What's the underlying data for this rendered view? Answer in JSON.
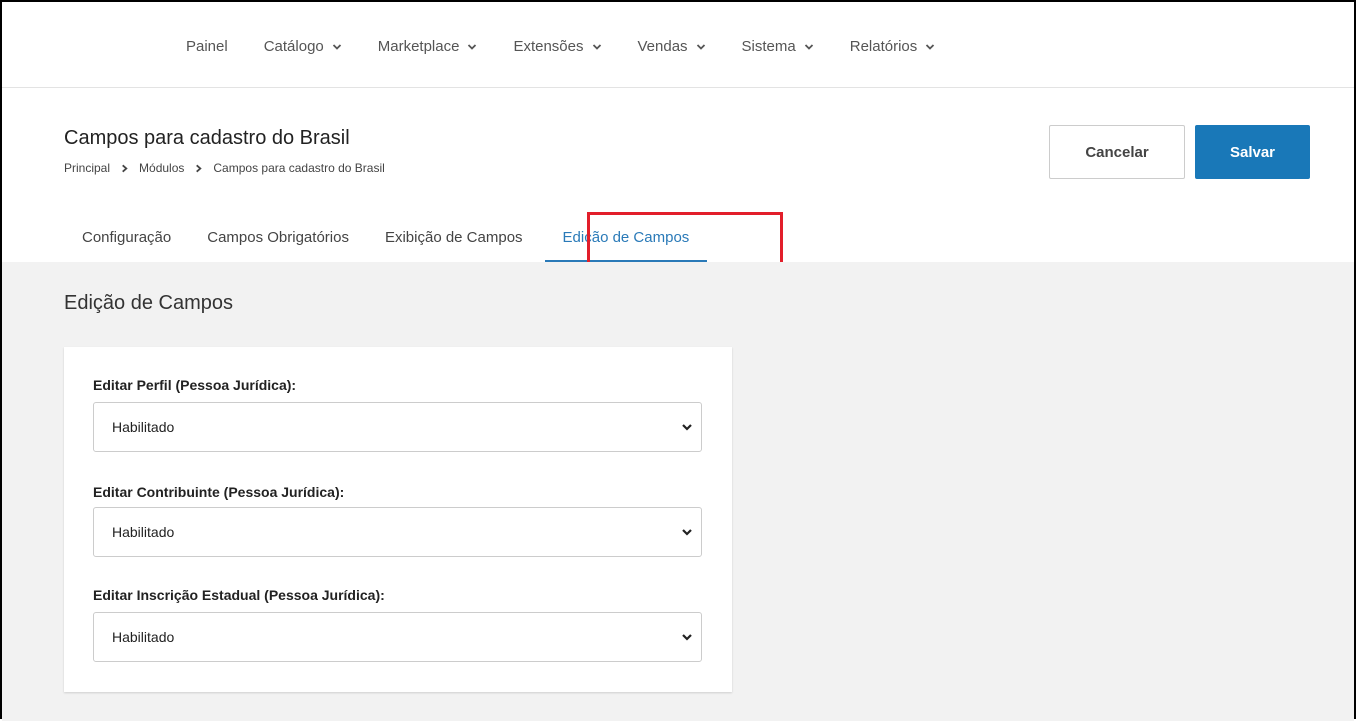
{
  "nav": {
    "items": [
      {
        "label": "Painel",
        "has_dropdown": false
      },
      {
        "label": "Catálogo",
        "has_dropdown": true
      },
      {
        "label": "Marketplace",
        "has_dropdown": true
      },
      {
        "label": "Extensões",
        "has_dropdown": true
      },
      {
        "label": "Vendas",
        "has_dropdown": true
      },
      {
        "label": "Sistema",
        "has_dropdown": true
      },
      {
        "label": "Relatórios",
        "has_dropdown": true
      }
    ]
  },
  "header": {
    "title": "Campos para cadastro do Brasil",
    "breadcrumb": [
      "Principal",
      "Módulos",
      "Campos para cadastro do Brasil"
    ],
    "cancel_label": "Cancelar",
    "save_label": "Salvar"
  },
  "tabs": [
    {
      "label": "Configuração",
      "active": false
    },
    {
      "label": "Campos Obrigatórios",
      "active": false
    },
    {
      "label": "Exibição de Campos",
      "active": false
    },
    {
      "label": "Edição de Campos",
      "active": true
    }
  ],
  "section": {
    "title": "Edição de Campos",
    "fields": [
      {
        "label": "Editar Perfil (Pessoa Jurídica):",
        "value": "Habilitado"
      },
      {
        "label": "Editar Contribuinte (Pessoa Jurídica):",
        "value": "Habilitado"
      },
      {
        "label": "Editar Inscrição Estadual (Pessoa Jurídica):",
        "value": "Habilitado"
      }
    ]
  },
  "colors": {
    "primary": "#1978b8",
    "active_tab": "#2a7ab8",
    "highlight": "#e21e2a",
    "content_bg": "#f2f2f2"
  },
  "icons": {
    "nav_dropdown": "chevron-down-icon",
    "breadcrumb_separator": "chevron-right-icon",
    "select_caret": "chevron-down-icon"
  }
}
